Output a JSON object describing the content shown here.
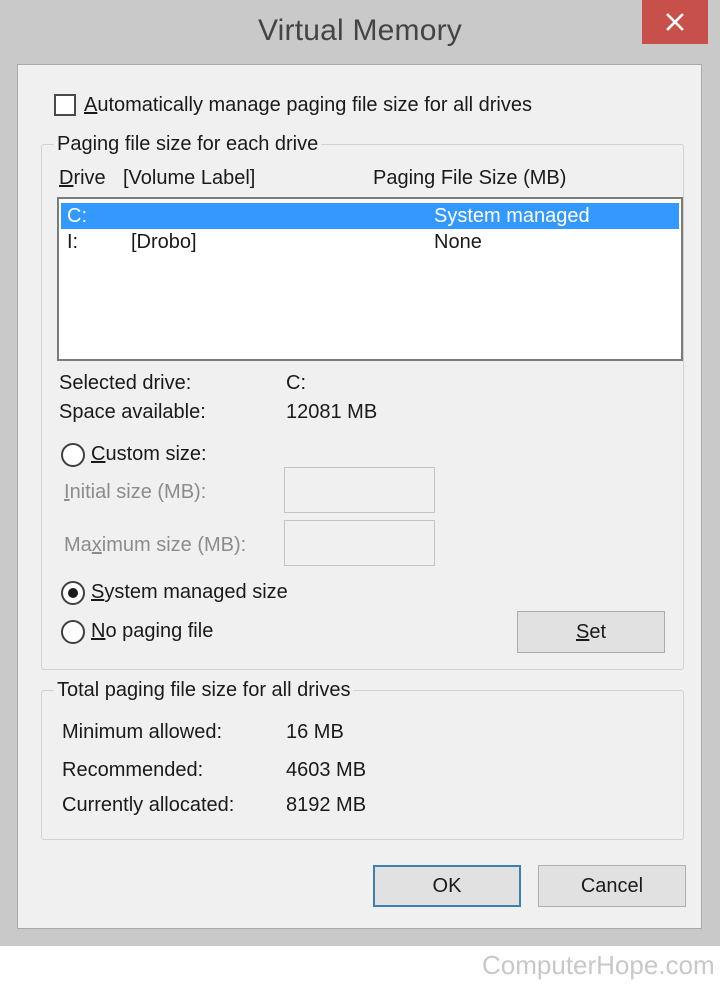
{
  "window": {
    "title": "Virtual Memory",
    "close_icon": "close-icon",
    "close_button_color": "#c7504a"
  },
  "auto_manage": {
    "label": "Automatically manage paging file size for all drives",
    "checked": false
  },
  "paging_group": {
    "legend": "Paging file size for each drive",
    "columns": {
      "drive": "Drive",
      "volume_label": "[Volume Label]",
      "size": "Paging File Size (MB)"
    },
    "rows": [
      {
        "drive": "C:",
        "label": "",
        "size": "System managed",
        "selected": true
      },
      {
        "drive": "I:",
        "label": "[Drobo]",
        "size": "None",
        "selected": false
      }
    ],
    "selection_color": "#3399ff",
    "selected_drive_label": "Selected drive:",
    "selected_drive_value": "C:",
    "space_available_label": "Space available:",
    "space_available_value": "12081 MB",
    "custom_size": {
      "label": "Custom size:",
      "checked": false,
      "initial_label": "Initial size (MB):",
      "initial_value": "",
      "maximum_label": "Maximum size (MB):",
      "maximum_value": ""
    },
    "system_managed": {
      "label": "System managed size",
      "checked": true
    },
    "no_paging": {
      "label": "No paging file",
      "checked": false
    },
    "set_button": "Set"
  },
  "total_group": {
    "legend": "Total paging file size for all drives",
    "minimum_label": "Minimum allowed:",
    "minimum_value": "16 MB",
    "recommended_label": "Recommended:",
    "recommended_value": "4603 MB",
    "allocated_label": "Currently allocated:",
    "allocated_value": "8192 MB"
  },
  "buttons": {
    "ok": "OK",
    "cancel": "Cancel"
  },
  "watermark": "ComputerHope.com"
}
